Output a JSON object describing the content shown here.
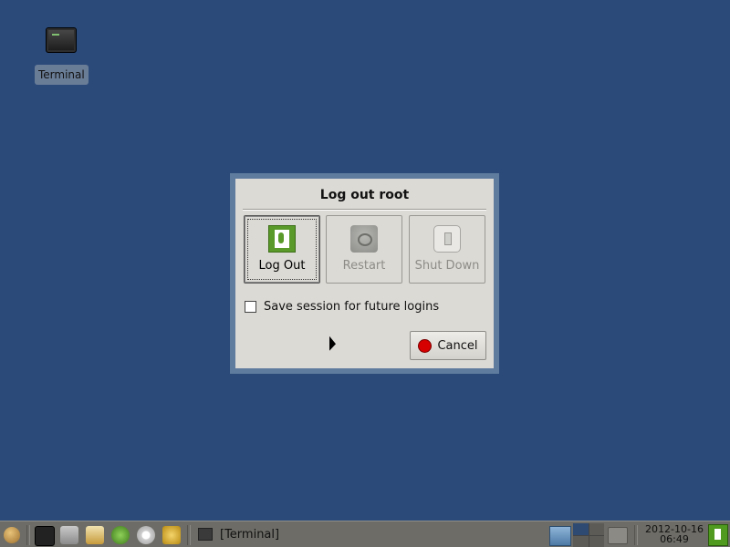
{
  "desktop": {
    "icons": [
      {
        "label": "Terminal",
        "icon": "terminal-icon"
      }
    ]
  },
  "dialog": {
    "title": "Log out root",
    "actions": [
      {
        "label": "Log Out",
        "icon": "exit-door-icon",
        "enabled": true
      },
      {
        "label": "Restart",
        "icon": "restart-icon",
        "enabled": false
      },
      {
        "label": "Shut Down",
        "icon": "power-switch-icon",
        "enabled": false
      }
    ],
    "save_session_label": "Save session for future logins",
    "save_session_checked": false,
    "cancel_label": "Cancel",
    "cancel_icon": "stop-icon"
  },
  "taskbar": {
    "launchers": [
      "start-menu-icon",
      "terminal-icon",
      "settings-icon",
      "text-editor-icon",
      "leaf-icon",
      "cd-icon",
      "browser-icon"
    ],
    "window_button_label": "[Terminal]",
    "clock_date": "2012-10-16",
    "clock_time": "06:49",
    "network_icon": "network-icon",
    "screenshot_icon": "screenshot-icon",
    "exit_icon": "exit-icon"
  },
  "colors": {
    "desktop_bg": "#2b4a7a",
    "dialog_bg": "#dcdad5",
    "taskbar_bg": "#6d6c66",
    "cancel_icon": "#d60000",
    "logout_icon": "#5a9a2a"
  }
}
